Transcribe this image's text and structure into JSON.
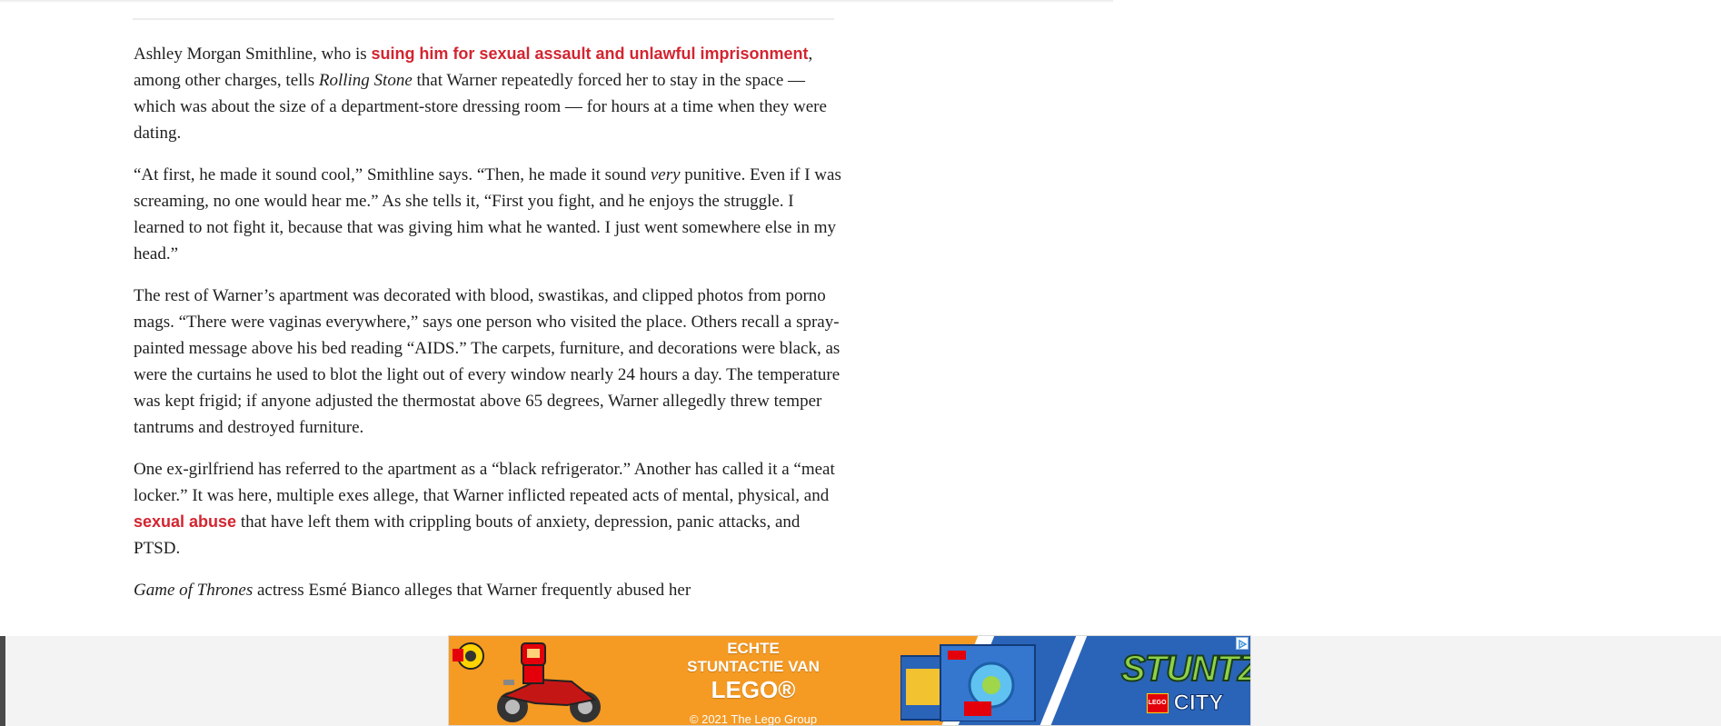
{
  "article": {
    "p1": {
      "t1": "Ashley Morgan Smithline, who is ",
      "link1": "suing him for sexual assault and unlawful imprisonment",
      "t2": ", among other charges, tells ",
      "em1": "Rolling Stone",
      "t3": " that Warner repeatedly forced her to stay in the space — which was about the size of a department-store dressing room — for hours at a time when they were dating."
    },
    "p2": {
      "t1": "“At first, he made it sound cool,” Smithline says. “Then, he made it sound ",
      "em1": "very",
      "t2": " punitive. Even if I was screaming, no one would hear me.” As she tells it, “First you fight, and he enjoys the struggle. I learned to not fight it, because that was giving him what he wanted. I just went somewhere else in my head.”"
    },
    "p3": {
      "t1": "The rest of Warner’s apartment was decorated with blood, swastikas, and clipped photos from porno mags. “There were vaginas everywhere,” says one person who visited the place. Others recall a spray-painted message above his bed reading “AIDS.” The carpets, furniture, and decorations were black, as were the curtains he used to blot the light out of every window nearly 24 hours a day. The temperature was kept frigid; if anyone adjusted the thermostat above 65 degrees, Warner allegedly threw temper tantrums and destroyed furniture."
    },
    "p4": {
      "t1": "One ex-girlfriend has referred to the apartment as a “black refrigerator.” Another has called it a “meat locker.” It was here, multiple exes allege, that Warner inflicted repeated acts of mental, physical, and ",
      "link1": "sexual abuse",
      "t2": " that have left them with crippling bouts of anxiety, depression, panic attacks, and PTSD."
    },
    "p5": {
      "em1": "Game of Thrones",
      "t1": " actress Esmé Bianco alleges that Warner frequently abused her"
    }
  },
  "ad": {
    "line1": "ECHTE",
    "line2": "STUNTACTIE VAN",
    "line3": "LEGO®",
    "copyright": "© 2021 The Lego Group",
    "brand_title": "STUNTZ",
    "brand_lego": "LEGO",
    "brand_city": "CITY",
    "colors": {
      "orange": "#f59a23",
      "blue": "#2a64b8",
      "stuntz_green": "#8ed14a"
    },
    "adchoices_icon": "adchoices-icon"
  },
  "colors": {
    "link": "#d32531",
    "text": "#1f1f1f"
  }
}
